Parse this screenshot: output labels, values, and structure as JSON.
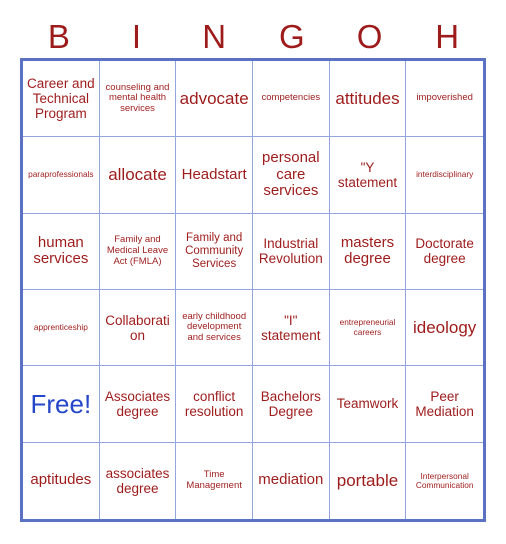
{
  "card": {
    "title_letters": [
      "B",
      "I",
      "N",
      "G",
      "O",
      "H"
    ],
    "colors": {
      "text": "#9e1b1b",
      "free_text": "#2446c8",
      "grid_line": "#93a4de",
      "grid_border": "#5b72c4",
      "background": "#ffffff"
    },
    "columns": 6,
    "rows": 6,
    "free_space_label": "Free!",
    "cells": [
      [
        {
          "text": "Career and Technical Program",
          "size": "fs-md",
          "free": false
        },
        {
          "text": "counseling and mental health services",
          "size": "fs-xs",
          "free": false
        },
        {
          "text": "advocate",
          "size": "fs-xl",
          "free": false
        },
        {
          "text": "competencies",
          "size": "fs-xs",
          "free": false
        },
        {
          "text": "attitudes",
          "size": "fs-xl",
          "free": false
        },
        {
          "text": "impoverished",
          "size": "fs-xs",
          "free": false
        }
      ],
      [
        {
          "text": "paraprofessionals",
          "size": "fs-xxs",
          "free": false
        },
        {
          "text": "allocate",
          "size": "fs-xl",
          "free": false
        },
        {
          "text": "Headstart",
          "size": "fs-lg",
          "free": false
        },
        {
          "text": "personal care services",
          "size": "fs-lg",
          "free": false
        },
        {
          "text": "\"Y statement",
          "size": "fs-md",
          "free": false
        },
        {
          "text": "interdisciplinary",
          "size": "fs-xxs",
          "free": false
        }
      ],
      [
        {
          "text": "human services",
          "size": "fs-lg",
          "free": false
        },
        {
          "text": "Family and Medical Leave Act (FMLA)",
          "size": "fs-xs",
          "free": false
        },
        {
          "text": "Family and Community Services",
          "size": "fs-sm",
          "free": false
        },
        {
          "text": "Industrial Revolution",
          "size": "fs-md",
          "free": false
        },
        {
          "text": "masters degree",
          "size": "fs-lg",
          "free": false
        },
        {
          "text": "Doctorate degree",
          "size": "fs-md",
          "free": false
        }
      ],
      [
        {
          "text": "apprenticeship",
          "size": "fs-xxs",
          "free": false
        },
        {
          "text": "Collaboration",
          "size": "fs-md",
          "free": false
        },
        {
          "text": "early childhood development and services",
          "size": "fs-xs",
          "free": false
        },
        {
          "text": "\"I\" statement",
          "size": "fs-md",
          "free": false
        },
        {
          "text": "entrepreneurial careers",
          "size": "fs-xxs",
          "free": false
        },
        {
          "text": "ideology",
          "size": "fs-xl",
          "free": false
        }
      ],
      [
        {
          "text": "Free!",
          "size": "fs-xxl",
          "free": true
        },
        {
          "text": "Associates degree",
          "size": "fs-md",
          "free": false
        },
        {
          "text": "conflict resolution",
          "size": "fs-md",
          "free": false
        },
        {
          "text": "Bachelors Degree",
          "size": "fs-md",
          "free": false
        },
        {
          "text": "Teamwork",
          "size": "fs-md",
          "free": false
        },
        {
          "text": "Peer Mediation",
          "size": "fs-md",
          "free": false
        }
      ],
      [
        {
          "text": "aptitudes",
          "size": "fs-lg",
          "free": false
        },
        {
          "text": "associates degree",
          "size": "fs-md",
          "free": false
        },
        {
          "text": "Time Management",
          "size": "fs-xs",
          "free": false
        },
        {
          "text": "mediation",
          "size": "fs-lg",
          "free": false
        },
        {
          "text": "portable",
          "size": "fs-xl",
          "free": false
        },
        {
          "text": "Interpersonal Communication",
          "size": "fs-xxs",
          "free": false
        }
      ]
    ]
  }
}
